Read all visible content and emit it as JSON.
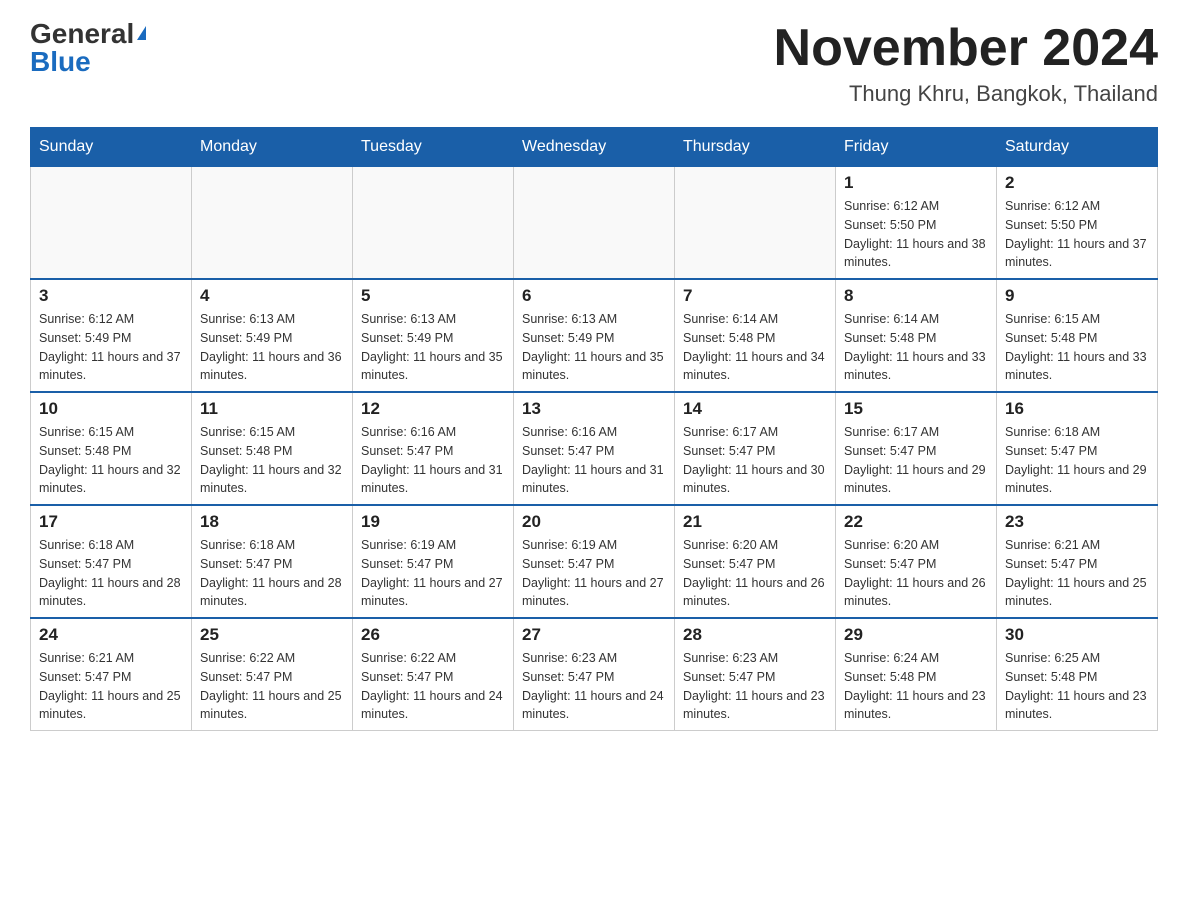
{
  "header": {
    "logo": {
      "general_text": "General",
      "blue_text": "Blue"
    },
    "title": "November 2024",
    "location": "Thung Khru, Bangkok, Thailand"
  },
  "weekdays": [
    "Sunday",
    "Monday",
    "Tuesday",
    "Wednesday",
    "Thursday",
    "Friday",
    "Saturday"
  ],
  "weeks": [
    [
      {
        "day": "",
        "info": ""
      },
      {
        "day": "",
        "info": ""
      },
      {
        "day": "",
        "info": ""
      },
      {
        "day": "",
        "info": ""
      },
      {
        "day": "",
        "info": ""
      },
      {
        "day": "1",
        "info": "Sunrise: 6:12 AM\nSunset: 5:50 PM\nDaylight: 11 hours and 38 minutes."
      },
      {
        "day": "2",
        "info": "Sunrise: 6:12 AM\nSunset: 5:50 PM\nDaylight: 11 hours and 37 minutes."
      }
    ],
    [
      {
        "day": "3",
        "info": "Sunrise: 6:12 AM\nSunset: 5:49 PM\nDaylight: 11 hours and 37 minutes."
      },
      {
        "day": "4",
        "info": "Sunrise: 6:13 AM\nSunset: 5:49 PM\nDaylight: 11 hours and 36 minutes."
      },
      {
        "day": "5",
        "info": "Sunrise: 6:13 AM\nSunset: 5:49 PM\nDaylight: 11 hours and 35 minutes."
      },
      {
        "day": "6",
        "info": "Sunrise: 6:13 AM\nSunset: 5:49 PM\nDaylight: 11 hours and 35 minutes."
      },
      {
        "day": "7",
        "info": "Sunrise: 6:14 AM\nSunset: 5:48 PM\nDaylight: 11 hours and 34 minutes."
      },
      {
        "day": "8",
        "info": "Sunrise: 6:14 AM\nSunset: 5:48 PM\nDaylight: 11 hours and 33 minutes."
      },
      {
        "day": "9",
        "info": "Sunrise: 6:15 AM\nSunset: 5:48 PM\nDaylight: 11 hours and 33 minutes."
      }
    ],
    [
      {
        "day": "10",
        "info": "Sunrise: 6:15 AM\nSunset: 5:48 PM\nDaylight: 11 hours and 32 minutes."
      },
      {
        "day": "11",
        "info": "Sunrise: 6:15 AM\nSunset: 5:48 PM\nDaylight: 11 hours and 32 minutes."
      },
      {
        "day": "12",
        "info": "Sunrise: 6:16 AM\nSunset: 5:47 PM\nDaylight: 11 hours and 31 minutes."
      },
      {
        "day": "13",
        "info": "Sunrise: 6:16 AM\nSunset: 5:47 PM\nDaylight: 11 hours and 31 minutes."
      },
      {
        "day": "14",
        "info": "Sunrise: 6:17 AM\nSunset: 5:47 PM\nDaylight: 11 hours and 30 minutes."
      },
      {
        "day": "15",
        "info": "Sunrise: 6:17 AM\nSunset: 5:47 PM\nDaylight: 11 hours and 29 minutes."
      },
      {
        "day": "16",
        "info": "Sunrise: 6:18 AM\nSunset: 5:47 PM\nDaylight: 11 hours and 29 minutes."
      }
    ],
    [
      {
        "day": "17",
        "info": "Sunrise: 6:18 AM\nSunset: 5:47 PM\nDaylight: 11 hours and 28 minutes."
      },
      {
        "day": "18",
        "info": "Sunrise: 6:18 AM\nSunset: 5:47 PM\nDaylight: 11 hours and 28 minutes."
      },
      {
        "day": "19",
        "info": "Sunrise: 6:19 AM\nSunset: 5:47 PM\nDaylight: 11 hours and 27 minutes."
      },
      {
        "day": "20",
        "info": "Sunrise: 6:19 AM\nSunset: 5:47 PM\nDaylight: 11 hours and 27 minutes."
      },
      {
        "day": "21",
        "info": "Sunrise: 6:20 AM\nSunset: 5:47 PM\nDaylight: 11 hours and 26 minutes."
      },
      {
        "day": "22",
        "info": "Sunrise: 6:20 AM\nSunset: 5:47 PM\nDaylight: 11 hours and 26 minutes."
      },
      {
        "day": "23",
        "info": "Sunrise: 6:21 AM\nSunset: 5:47 PM\nDaylight: 11 hours and 25 minutes."
      }
    ],
    [
      {
        "day": "24",
        "info": "Sunrise: 6:21 AM\nSunset: 5:47 PM\nDaylight: 11 hours and 25 minutes."
      },
      {
        "day": "25",
        "info": "Sunrise: 6:22 AM\nSunset: 5:47 PM\nDaylight: 11 hours and 25 minutes."
      },
      {
        "day": "26",
        "info": "Sunrise: 6:22 AM\nSunset: 5:47 PM\nDaylight: 11 hours and 24 minutes."
      },
      {
        "day": "27",
        "info": "Sunrise: 6:23 AM\nSunset: 5:47 PM\nDaylight: 11 hours and 24 minutes."
      },
      {
        "day": "28",
        "info": "Sunrise: 6:23 AM\nSunset: 5:47 PM\nDaylight: 11 hours and 23 minutes."
      },
      {
        "day": "29",
        "info": "Sunrise: 6:24 AM\nSunset: 5:48 PM\nDaylight: 11 hours and 23 minutes."
      },
      {
        "day": "30",
        "info": "Sunrise: 6:25 AM\nSunset: 5:48 PM\nDaylight: 11 hours and 23 minutes."
      }
    ]
  ]
}
